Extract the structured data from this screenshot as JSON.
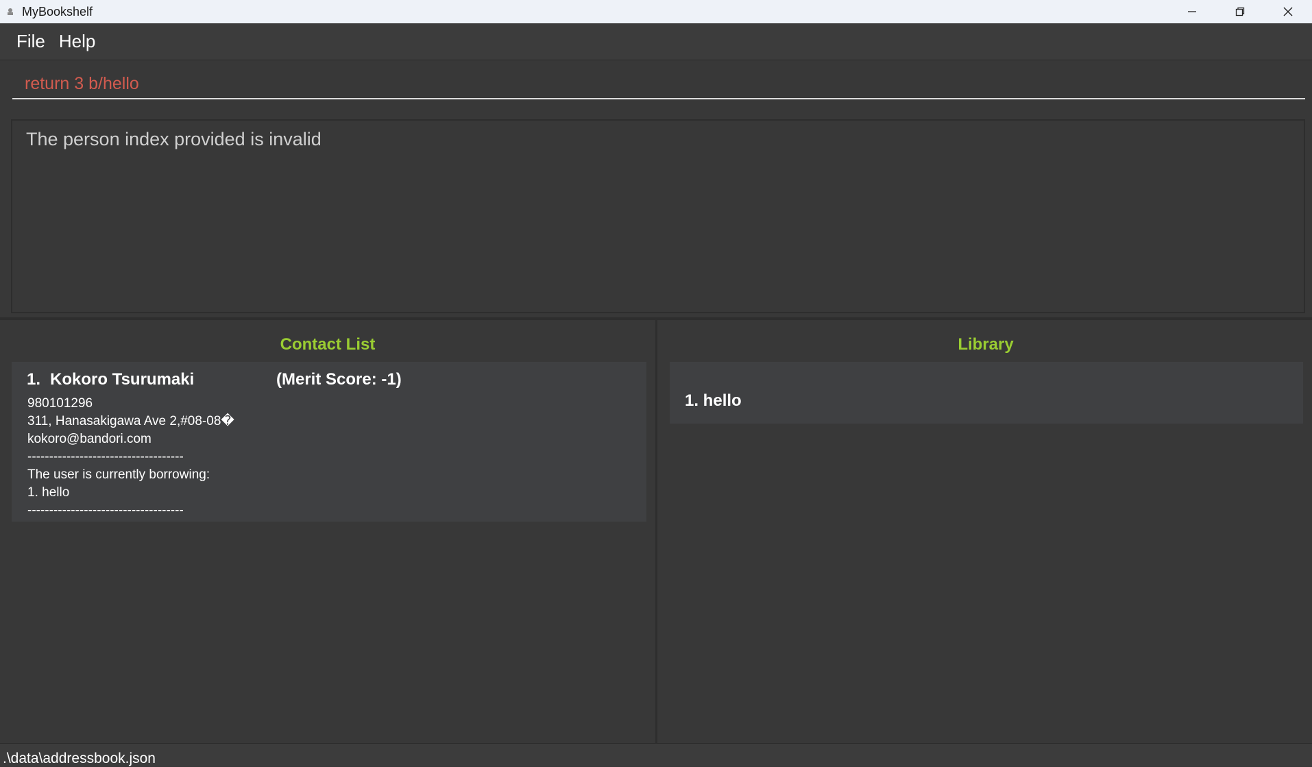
{
  "window": {
    "title": "MyBookshelf",
    "controls": [
      "minimize-icon",
      "restore-icon",
      "close-icon"
    ]
  },
  "menu": {
    "items": [
      {
        "label": "File"
      },
      {
        "label": "Help"
      }
    ]
  },
  "command": {
    "value": "return 3 b/hello",
    "color": "#d25b4f"
  },
  "result": {
    "message": "The person index provided is invalid"
  },
  "contact_list": {
    "title": "Contact List",
    "persons": [
      {
        "index": "1.",
        "name": "Kokoro Tsurumaki",
        "merit": "(Merit Score: -1)",
        "phone": "980101296",
        "address": "311, Hanasakigawa Ave 2,#08-08�",
        "email": "kokoro@bandori.com",
        "separator": "------------------------------------",
        "borrowing_label": "The user is currently borrowing:",
        "borrowed": [
          "1. hello"
        ],
        "separator_end": "------------------------------------"
      }
    ]
  },
  "library": {
    "title": "Library",
    "books": [
      "1. hello"
    ]
  },
  "status": {
    "path": ".\\data\\addressbook.json"
  },
  "colors": {
    "accent_title": "#9acd32",
    "background": "#383838",
    "card": "#3f4042"
  }
}
